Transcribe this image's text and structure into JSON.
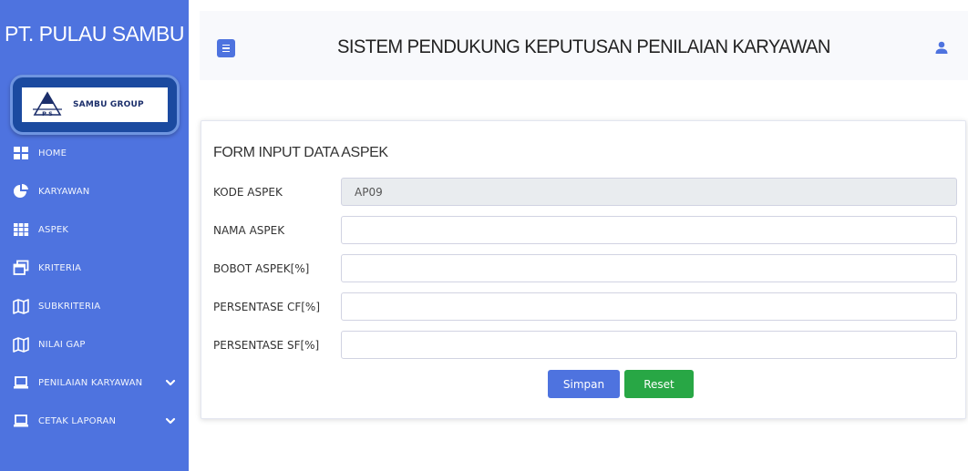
{
  "sidebar": {
    "brand": "PT. PULAU SAMBU",
    "logo": {
      "mark_text": "P S",
      "text": "SAMBU GROUP"
    },
    "items": [
      {
        "label": "HOME",
        "icon": "grid-2x2-icon"
      },
      {
        "label": "KARYAWAN",
        "icon": "pie-chart-icon"
      },
      {
        "label": "ASPEK",
        "icon": "grid-3x3-icon"
      },
      {
        "label": "KRITERIA",
        "icon": "window-restore-icon"
      },
      {
        "label": "SUBKRITERIA",
        "icon": "map-icon"
      },
      {
        "label": "NILAI GAP",
        "icon": "map-icon"
      },
      {
        "label": "PENILAIAN KARYAWAN",
        "icon": "laptop-icon",
        "has_chevron": true
      },
      {
        "label": "CETAK LAPORAN",
        "icon": "laptop-icon",
        "has_chevron": true
      }
    ]
  },
  "topbar": {
    "title": "SISTEM PENDUKUNG KEPUTUSAN PENILAIAN KARYAWAN",
    "menu_icon": "hamburger-icon",
    "user_icon": "user-icon"
  },
  "form": {
    "title": "FORM INPUT DATA ASPEK",
    "fields": [
      {
        "label": "KODE ASPEK",
        "value": "AP09",
        "readonly": true
      },
      {
        "label": "NAMA ASPEK",
        "value": ""
      },
      {
        "label": "BOBOT ASPEK[%]",
        "value": ""
      },
      {
        "label": "PERSENTASE CF[%]",
        "value": ""
      },
      {
        "label": "PERSENTASE SF[%]",
        "value": ""
      }
    ],
    "submit_label": "Simpan",
    "reset_label": "Reset"
  },
  "colors": {
    "sidebar": "#4e73df",
    "primary": "#4e73df",
    "success": "#28a745",
    "topbar": "#f8f9fc"
  }
}
